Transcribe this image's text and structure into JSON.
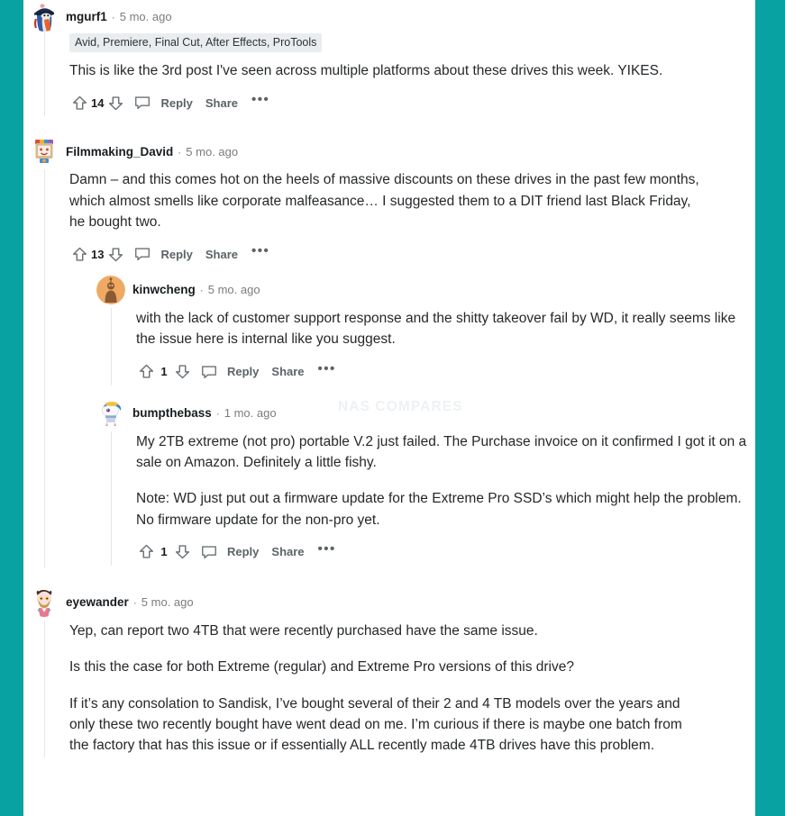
{
  "page": {
    "watermark": "NAS COMPARES",
    "accent_teal": "#08a2a2",
    "flair_bg": "#eaedef",
    "text_color": "#25282b",
    "meta_color": "#7c7c7c"
  },
  "action_labels": {
    "reply": "Reply",
    "share": "Share",
    "more": "•••",
    "separator": "·"
  },
  "comments": [
    {
      "id": "c1",
      "author": "mgurf1",
      "timestamp": "5 mo. ago",
      "separator": "·",
      "avatar": "avatar-mgurf1",
      "flair": "Avid, Premiere, Final Cut, After Effects, ProTools",
      "score": "14",
      "paragraphs": [
        "This is like the 3rd post I've seen across multiple platforms about these drives this week. YIKES."
      ],
      "reply_label": "Reply",
      "share_label": "Share",
      "more_label": "•••"
    },
    {
      "id": "c2",
      "author": "Filmmaking_David",
      "timestamp": "5 mo. ago",
      "separator": "·",
      "avatar": "avatar-filmmaking-david",
      "flair": null,
      "score": "13",
      "paragraphs": [
        "Damn – and this comes hot on the heels of massive discounts on these drives in the past few months, which almost smells like corporate malfeasance… I suggested them to a DIT friend last Black Friday, he bought two."
      ],
      "reply_label": "Reply",
      "share_label": "Share",
      "more_label": "•••",
      "replies": [
        {
          "id": "c2r1",
          "author": "kinwcheng",
          "timestamp": "5 mo. ago",
          "separator": "·",
          "avatar": "avatar-kinwcheng",
          "score": "1",
          "paragraphs": [
            "with the lack of customer support response and the shitty takeover fail by WD, it really seems like the issue here is internal like you suggest."
          ],
          "reply_label": "Reply",
          "share_label": "Share",
          "more_label": "•••"
        },
        {
          "id": "c2r2",
          "author": "bumpthebass",
          "timestamp": "1 mo. ago",
          "separator": "·",
          "avatar": "avatar-bumpthebass",
          "score": "1",
          "paragraphs": [
            "My 2TB extreme (not pro) portable V.2 just failed. The Purchase invoice on it confirmed I got it on a sale on Amazon. Definitely a little fishy.",
            "Note: WD just put out a firmware update for the Extreme Pro SSD’s which might help the problem. No firmware update for the non-pro yet."
          ],
          "reply_label": "Reply",
          "share_label": "Share",
          "more_label": "•••"
        }
      ]
    },
    {
      "id": "c3",
      "author": "eyewander",
      "timestamp": "5 mo. ago",
      "separator": "·",
      "avatar": "avatar-eyewander",
      "flair": null,
      "paragraphs": [
        "Yep, can report two 4TB that were recently purchased have the same issue.",
        "Is this the case for both Extreme (regular) and Extreme Pro versions of this drive?",
        "If it’s any consolation to Sandisk, I’ve bought several of their 2 and 4 TB models over the years and only these two recently bought have went dead on me. I’m curious if there is maybe one batch from the factory that has this issue or if essentially ALL recently made 4TB drives have this problem."
      ]
    }
  ]
}
